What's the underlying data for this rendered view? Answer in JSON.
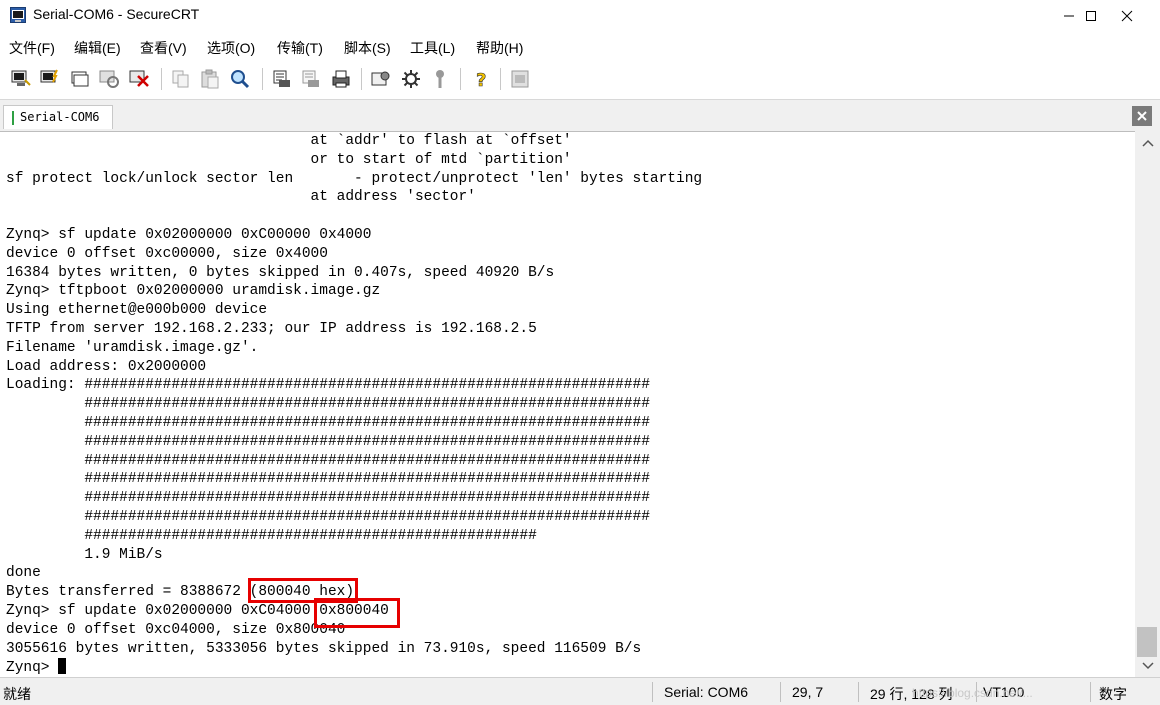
{
  "window": {
    "title": "Serial-COM6 - SecureCRT",
    "icon": "securecrt-app-icon"
  },
  "menu": [
    "文件(F)",
    "编辑(E)",
    "查看(V)",
    "选项(O)",
    "传输(T)",
    "脚本(S)",
    "工具(L)",
    "帮助(H)"
  ],
  "toolbar": {
    "icons": [
      "connect-icon",
      "quick-connect-icon",
      "connect-tab-icon",
      "reconnect-icon",
      "disconnect-icon",
      "copy-icon",
      "paste-icon",
      "find-icon",
      "print-icon",
      "print-selection-icon",
      "print-setup-icon",
      "session-options-icon",
      "global-options-icon",
      "keymap-icon",
      "help-icon",
      "sftp-icon"
    ]
  },
  "tabs": [
    {
      "label": "Serial-COM6",
      "active": true
    }
  ],
  "terminal": {
    "lines": [
      "                                   at `addr' to flash at `offset'",
      "                                   or to start of mtd `partition'",
      "sf protect lock/unlock sector len       - protect/unprotect 'len' bytes starting",
      "                                   at address 'sector'",
      "",
      "Zynq> sf update 0x02000000 0xC00000 0x4000",
      "device 0 offset 0xc00000, size 0x4000",
      "16384 bytes written, 0 bytes skipped in 0.407s, speed 40920 B/s",
      "Zynq> tftpboot 0x02000000 uramdisk.image.gz",
      "Using ethernet@e000b000 device",
      "TFTP from server 192.168.2.233; our IP address is 192.168.2.5",
      "Filename 'uramdisk.image.gz'.",
      "Load address: 0x2000000",
      "Loading: #################################################################",
      "         #################################################################",
      "         #################################################################",
      "         #################################################################",
      "         #################################################################",
      "         #################################################################",
      "         #################################################################",
      "         #################################################################",
      "         ####################################################",
      "         1.9 MiB/s",
      "done",
      "Bytes transferred = 8388672 (800040 hex)",
      "Zynq> sf update 0x02000000 0xC04000 0x800040",
      "device 0 offset 0xc04000, size 0x800040",
      "3055616 bytes written, 5333056 bytes skipped in 73.910s, speed 116509 B/s",
      "Zynq> "
    ]
  },
  "status": {
    "ready": "就绪",
    "port": "Serial: COM6",
    "cursor": "29,  7",
    "size": "29 行, 128 列",
    "emulation": "VT100",
    "numlock": "数字"
  },
  "watermark": "https://blog.csdn.net/..."
}
